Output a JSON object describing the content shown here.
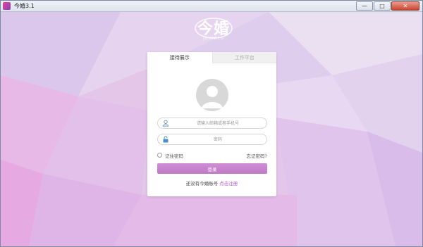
{
  "window": {
    "title": "今婚3.1",
    "minimize_glyph": "—",
    "maximize_glyph": "□",
    "close_glyph": "✕"
  },
  "logo": {
    "text": "今婚",
    "subtext": "JOINWED"
  },
  "tabs": [
    {
      "label": "接待展示",
      "active": true
    },
    {
      "label": "工作平台",
      "active": false
    }
  ],
  "form": {
    "username_placeholder": "请输入邮箱或者手机号",
    "password_placeholder": "密码",
    "remember_label": "记住密码",
    "forgot_label": "忘记密码?",
    "login_label": "登录",
    "register_prompt": "还没有今婚账号",
    "register_link": "点击注册"
  },
  "icons": {
    "user_field": "user-icon",
    "password_field": "lock-icon",
    "avatar": "avatar-placeholder-icon"
  },
  "colors": {
    "accent": "#c686cc",
    "link": "#b257c0",
    "lock_icon": "#4a8fd0",
    "background": "#e6c8ea"
  }
}
